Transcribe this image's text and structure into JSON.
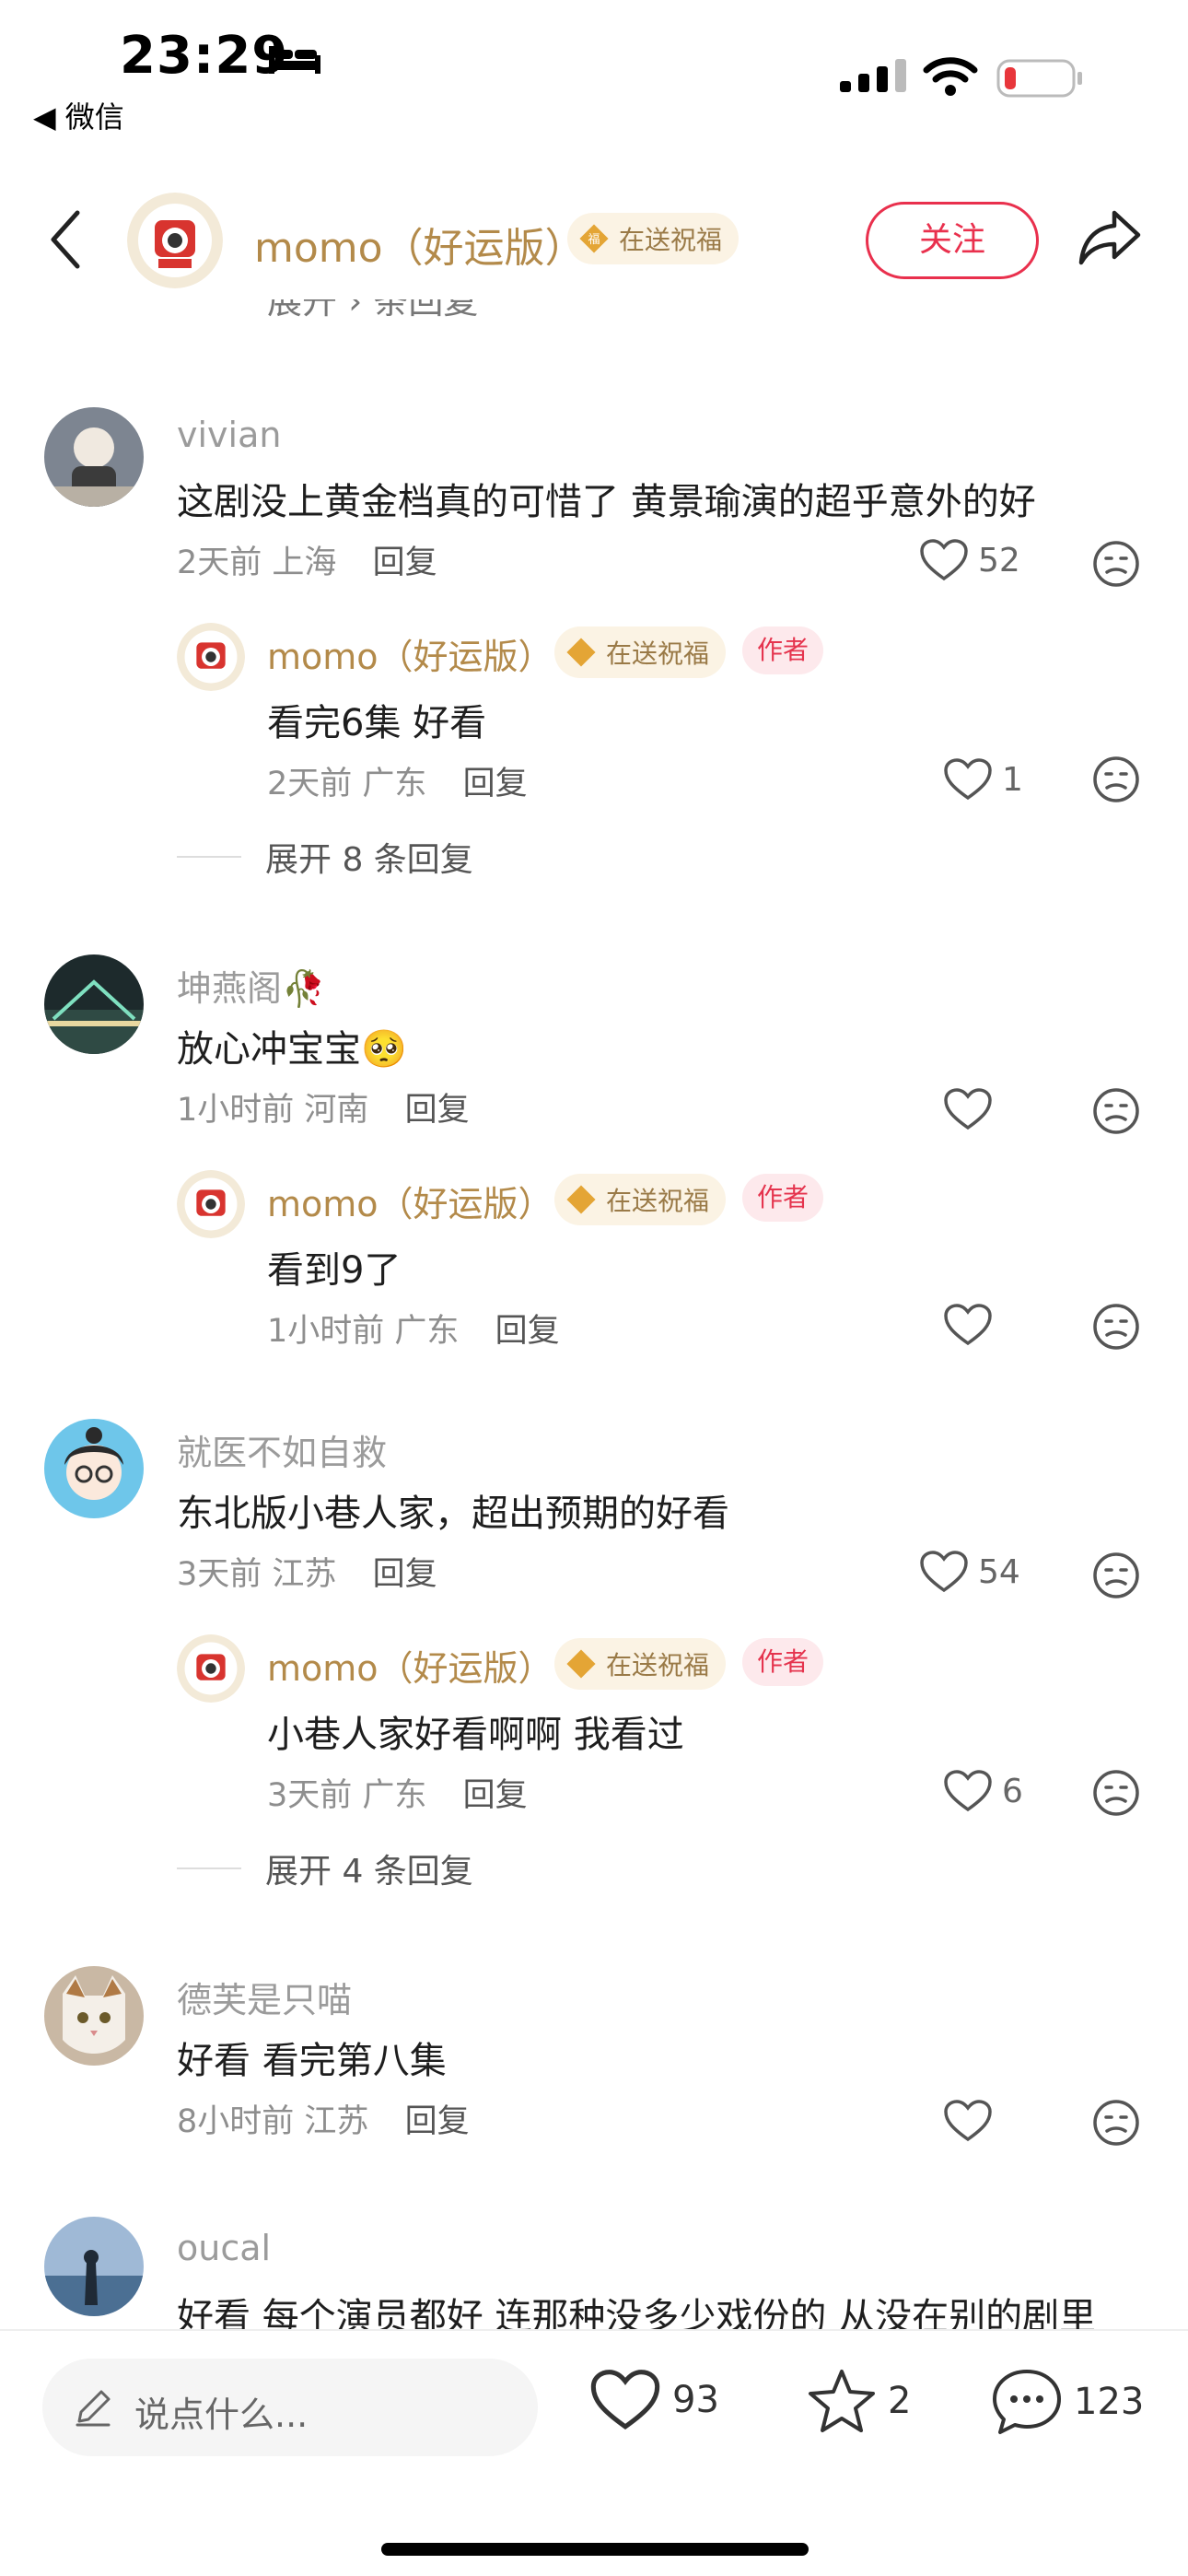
{
  "status": {
    "time": "23:29",
    "back_label": "◀ 微信"
  },
  "header": {
    "name": "momo（好运版）",
    "blessing": "在送祝福",
    "follow": "关注",
    "cut_text": "展开 › 条回复"
  },
  "labels": {
    "reply": "回复",
    "author": "作者"
  },
  "comments": [
    {
      "user": "vivian",
      "text": "这剧没上黄金档真的可惜了 黄景瑜演的超乎意外的好",
      "time": "2天前",
      "location": "上海",
      "likes": "52",
      "reply": {
        "user": "momo（好运版）",
        "text": "看完6集 好看",
        "time": "2天前",
        "location": "广东",
        "likes": "1"
      },
      "expand": "展开 8 条回复"
    },
    {
      "user": "坤燕阁🥀",
      "text": "放心冲宝宝🥺",
      "time": "1小时前",
      "location": "河南",
      "likes": "",
      "reply": {
        "user": "momo（好运版）",
        "text": "看到9了",
        "time": "1小时前",
        "location": "广东",
        "likes": ""
      }
    },
    {
      "user": "就医不如自救",
      "text": "东北版小巷人家，超出预期的好看",
      "time": "3天前",
      "location": "江苏",
      "likes": "54",
      "reply": {
        "user": "momo（好运版）",
        "text": "小巷人家好看啊啊 我看过",
        "time": "3天前",
        "location": "广东",
        "likes": "6"
      },
      "expand": "展开 4 条回复"
    },
    {
      "user": "德芙是只喵",
      "text": "好看   看完第八集",
      "time": "8小时前",
      "location": "江苏",
      "likes": ""
    },
    {
      "user": "oucal",
      "text": "好看 每个演员都好 连那种没多少戏份的 从没在别的剧里"
    }
  ],
  "bottom": {
    "placeholder": "说点什么...",
    "likes": "93",
    "stars": "2",
    "comments": "123"
  },
  "colors": {
    "accent": "#e9304d",
    "gold": "#b38a4a"
  }
}
